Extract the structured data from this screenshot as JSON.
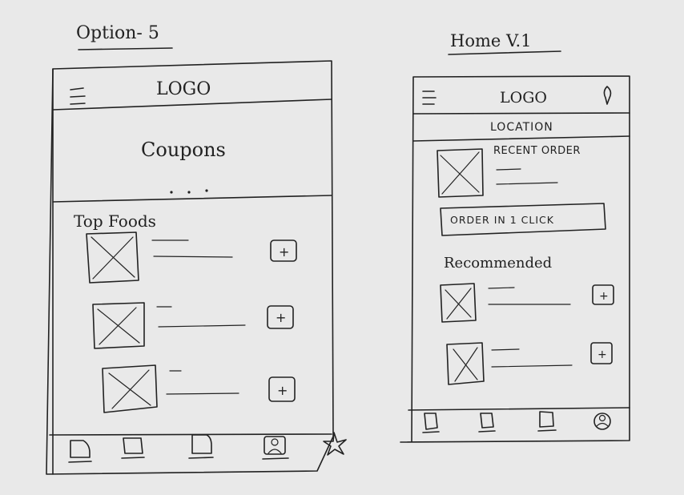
{
  "left_sketch": {
    "title": "Option- 5",
    "logo": "LOGO",
    "coupons": "Coupons",
    "section_label": "Top Foods",
    "add_button": "+",
    "items_count_note": "",
    "nav_icons": [
      "page-icon",
      "page-icon",
      "page-icon",
      "user-icon"
    ]
  },
  "right_sketch": {
    "title": "Home V.1",
    "logo": "LOGO",
    "location": "LOCATION",
    "recent_order": "RECENT ORDER",
    "order_button": "ORDER IN 1 CLICK",
    "section_label": "Recommended",
    "add_button": "+",
    "nav_icons": [
      "page-icon",
      "page-icon",
      "page-icon",
      "user-icon"
    ]
  },
  "colors": {
    "paper": "#e9e9e9",
    "ink": "#222222"
  }
}
